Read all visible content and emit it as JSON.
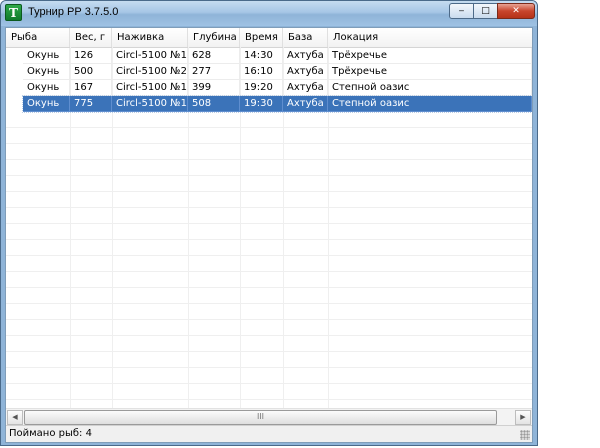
{
  "window": {
    "title": "Турнир РР 3.7.5.0",
    "icon_letter": "T",
    "controls": {
      "minimize": "‒",
      "maximize": "□",
      "close": "✕"
    }
  },
  "table": {
    "columns": [
      "Рыба",
      "Вес, г",
      "Наживка",
      "Глубина",
      "Время",
      "База",
      "Локация"
    ],
    "rows": [
      [
        "Окунь",
        "126",
        "Circl-5100 №1",
        "628",
        "14:30",
        "Ахтуба",
        "Трёхречье"
      ],
      [
        "Окунь",
        "500",
        "Circl-5100 №2",
        "277",
        "16:10",
        "Ахтуба",
        "Трёхречье"
      ],
      [
        "Окунь",
        "167",
        "Circl-5100 №1",
        "399",
        "19:20",
        "Ахтуба",
        "Степной оазис"
      ],
      [
        "Окунь",
        "775",
        "Circl-5100 №1",
        "508",
        "19:30",
        "Ахтуба",
        "Степной оазис"
      ]
    ],
    "selected_row": 4
  },
  "scrollbar": {
    "left_arrow": "◀",
    "right_arrow": "▶",
    "thumb_grip": "III"
  },
  "status": {
    "text": "Поймано рыб: 4"
  },
  "colors": {
    "selection": "#3b73b9",
    "titlebar": "#a6c6e6"
  }
}
